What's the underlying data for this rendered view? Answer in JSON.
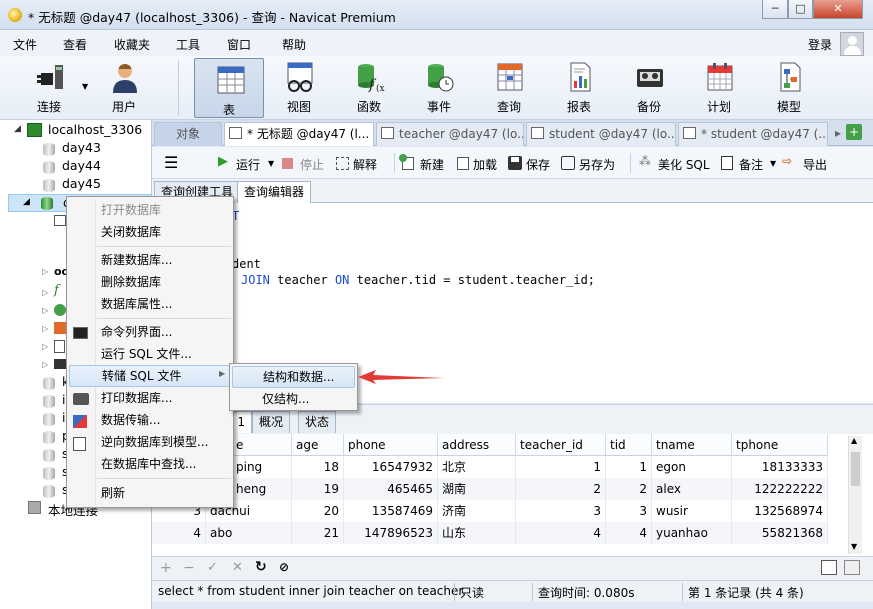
{
  "window": {
    "title": "* 无标题 @day47 (localhost_3306) - 查询 - Navicat Premium",
    "minimize": "─",
    "maximize": "□",
    "close": "✕"
  },
  "menubar": {
    "items": [
      "文件",
      "查看",
      "收藏夹",
      "工具",
      "窗口",
      "帮助"
    ],
    "login": "登录"
  },
  "toolbar": {
    "items": [
      {
        "label": "连接",
        "icon": "plug-icon"
      },
      {
        "label": "用户",
        "icon": "user-icon"
      },
      {
        "label": "表",
        "icon": "table-icon"
      },
      {
        "label": "视图",
        "icon": "view-glasses-icon"
      },
      {
        "label": "函数",
        "icon": "function-icon"
      },
      {
        "label": "事件",
        "icon": "event-clock-icon"
      },
      {
        "label": "查询",
        "icon": "query-icon"
      },
      {
        "label": "报表",
        "icon": "report-icon"
      },
      {
        "label": "备份",
        "icon": "backup-icon"
      },
      {
        "label": "计划",
        "icon": "calendar-icon"
      },
      {
        "label": "模型",
        "icon": "model-icon"
      }
    ]
  },
  "nav": {
    "connection": "localhost_3306",
    "databases": [
      "day43",
      "day44",
      "day45"
    ],
    "selected_db": "d",
    "partial_labels": [
      "k",
      "i",
      "i",
      "p",
      "s",
      "s",
      "s"
    ],
    "footer": "本地连接"
  },
  "tabs": {
    "object": "对象",
    "items": [
      "* 无标题 @day47 (l...",
      "teacher @day47 (lo...",
      "student @day47 (lo...",
      "* student @day47 (..."
    ]
  },
  "query_toolbar": {
    "run": "运行",
    "stop": "停止",
    "explain": "解释",
    "new": "新建",
    "load": "加载",
    "save": "保存",
    "save_as": "另存为",
    "beautify": "美化 SQL",
    "comment": "备注",
    "export": "导出"
  },
  "subtabs": {
    "builder": "查询创建工具",
    "editor": "查询编辑器"
  },
  "editor": {
    "line1": "T",
    "line2": "dent",
    "line3_kw1": "JOIN",
    "line3_a": " teacher ",
    "line3_kw2": "ON",
    "line3_b": " teacher.tid = student.teacher_id;"
  },
  "result_tabs": {
    "overview": "概况",
    "status": "状态",
    "result": "1"
  },
  "grid": {
    "columns": [
      "e",
      "age",
      "phone",
      "address",
      "teacher_id",
      "tid",
      "tname",
      "tphone"
    ],
    "rows": [
      [
        "ping",
        "18",
        "16547932",
        "北京",
        "1",
        "1",
        "egon",
        "18133333"
      ],
      [
        "heng",
        "19",
        "465465",
        "湖南",
        "2",
        "2",
        "alex",
        "122222222"
      ],
      [
        "3",
        "dachui",
        "20",
        "13587469",
        "济南",
        "3",
        "3",
        "wusir",
        "132568974"
      ],
      [
        "4",
        "abo",
        "21",
        "147896523",
        "山东",
        "4",
        "4",
        "yuanhao",
        "55821368"
      ]
    ]
  },
  "context_menu": {
    "items": [
      "打开数据库",
      "关闭数据库",
      "新建数据库...",
      "删除数据库",
      "数据库属性...",
      "命令列界面...",
      "运行 SQL 文件...",
      "转储 SQL 文件",
      "打印数据库...",
      "数据传输...",
      "逆向数据库到模型...",
      "在数据库中查找...",
      "刷新"
    ]
  },
  "submenu": {
    "items": [
      "结构和数据...",
      "仅结构..."
    ]
  },
  "status": {
    "sql": "select * from student inner join teacher on teacher.",
    "readonly": "只读",
    "time": "查询时间: 0.080s",
    "records": "第 1 条记录 (共 4 条)"
  },
  "colors": {
    "arrow": "#e53935",
    "accent": "#1a4bd6"
  }
}
